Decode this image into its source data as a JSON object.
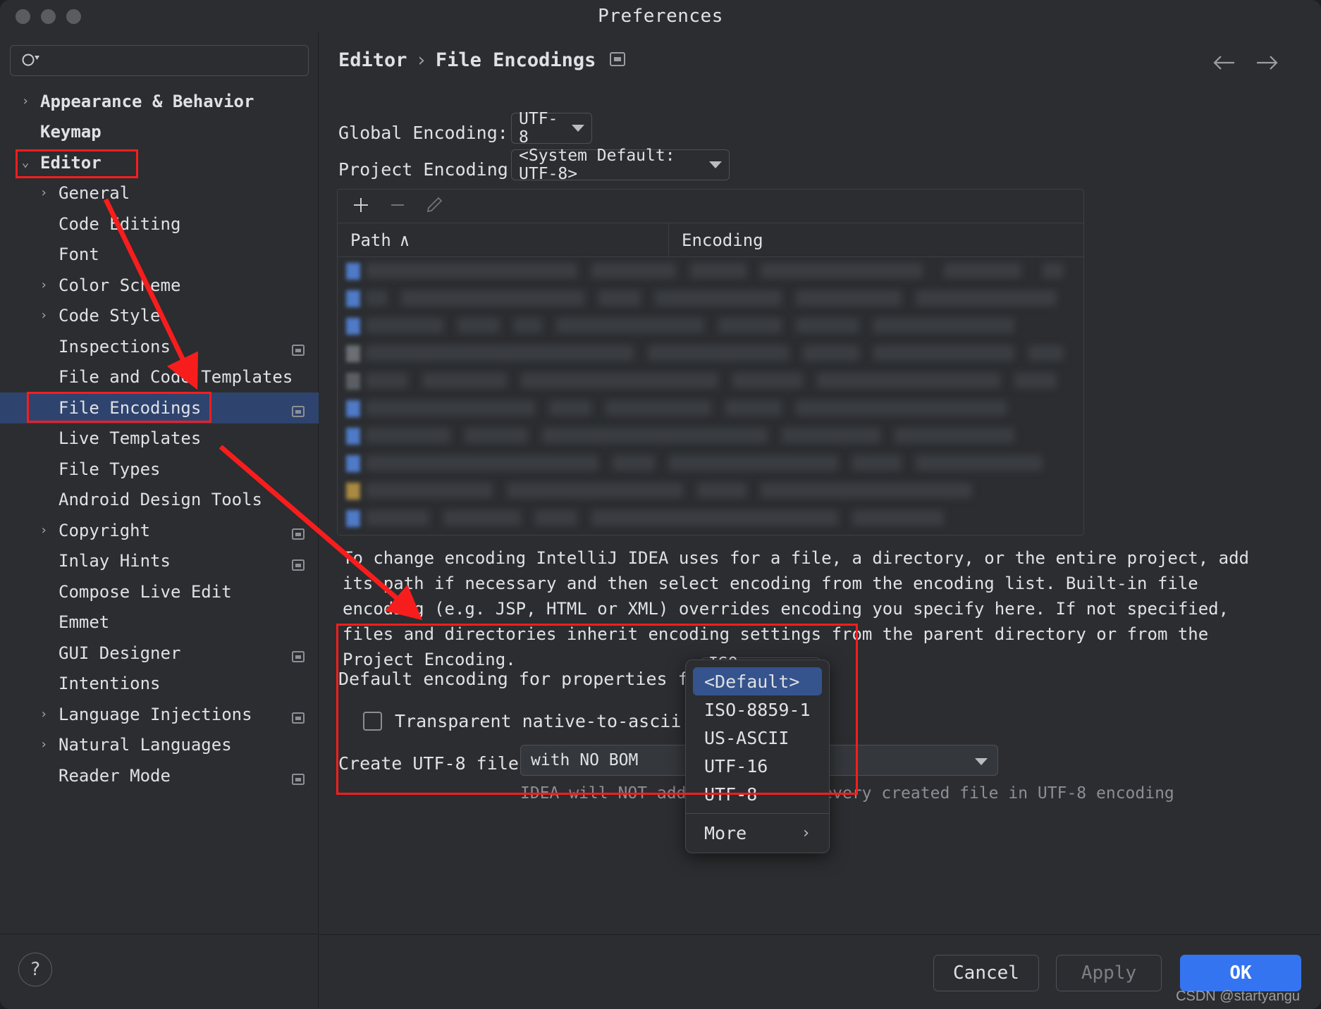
{
  "window": {
    "title": "Preferences",
    "traffic_lights": [
      "close",
      "minimize",
      "zoom"
    ]
  },
  "sidebar": {
    "search": {
      "value": "",
      "placeholder": ""
    },
    "items": [
      {
        "label": "Appearance & Behavior",
        "level": 0,
        "arrow": "›",
        "bold": true,
        "selected": false,
        "mod_icon": false
      },
      {
        "label": "Keymap",
        "level": 0,
        "arrow": "",
        "bold": true,
        "selected": false,
        "mod_icon": false
      },
      {
        "label": "Editor",
        "level": 0,
        "arrow": "⌄",
        "bold": true,
        "selected": false,
        "mod_icon": false
      },
      {
        "label": "General",
        "level": 1,
        "arrow": "›",
        "bold": false,
        "selected": false,
        "mod_icon": false
      },
      {
        "label": "Code Editing",
        "level": 1,
        "arrow": "",
        "bold": false,
        "selected": false,
        "mod_icon": false
      },
      {
        "label": "Font",
        "level": 1,
        "arrow": "",
        "bold": false,
        "selected": false,
        "mod_icon": false
      },
      {
        "label": "Color Scheme",
        "level": 1,
        "arrow": "›",
        "bold": false,
        "selected": false,
        "mod_icon": false
      },
      {
        "label": "Code Style",
        "level": 1,
        "arrow": "›",
        "bold": false,
        "selected": false,
        "mod_icon": false
      },
      {
        "label": "Inspections",
        "level": 1,
        "arrow": "",
        "bold": false,
        "selected": false,
        "mod_icon": true
      },
      {
        "label": "File and Code Templates",
        "level": 1,
        "arrow": "",
        "bold": false,
        "selected": false,
        "mod_icon": false
      },
      {
        "label": "File Encodings",
        "level": 1,
        "arrow": "",
        "bold": false,
        "selected": true,
        "mod_icon": true
      },
      {
        "label": "Live Templates",
        "level": 1,
        "arrow": "",
        "bold": false,
        "selected": false,
        "mod_icon": false
      },
      {
        "label": "File Types",
        "level": 1,
        "arrow": "",
        "bold": false,
        "selected": false,
        "mod_icon": false
      },
      {
        "label": "Android Design Tools",
        "level": 1,
        "arrow": "",
        "bold": false,
        "selected": false,
        "mod_icon": false
      },
      {
        "label": "Copyright",
        "level": 1,
        "arrow": "›",
        "bold": false,
        "selected": false,
        "mod_icon": true
      },
      {
        "label": "Inlay Hints",
        "level": 1,
        "arrow": "",
        "bold": false,
        "selected": false,
        "mod_icon": true
      },
      {
        "label": "Compose Live Edit",
        "level": 1,
        "arrow": "",
        "bold": false,
        "selected": false,
        "mod_icon": false
      },
      {
        "label": "Emmet",
        "level": 1,
        "arrow": "",
        "bold": false,
        "selected": false,
        "mod_icon": false
      },
      {
        "label": "GUI Designer",
        "level": 1,
        "arrow": "",
        "bold": false,
        "selected": false,
        "mod_icon": true
      },
      {
        "label": "Intentions",
        "level": 1,
        "arrow": "",
        "bold": false,
        "selected": false,
        "mod_icon": false
      },
      {
        "label": "Language Injections",
        "level": 1,
        "arrow": "›",
        "bold": false,
        "selected": false,
        "mod_icon": true
      },
      {
        "label": "Natural Languages",
        "level": 1,
        "arrow": "›",
        "bold": false,
        "selected": false,
        "mod_icon": false
      },
      {
        "label": "Reader Mode",
        "level": 1,
        "arrow": "",
        "bold": false,
        "selected": false,
        "mod_icon": true
      }
    ],
    "help_label": "?"
  },
  "main": {
    "breadcrumb": {
      "parent": "Editor",
      "separator": "›",
      "current": "File Encodings"
    },
    "global_encoding": {
      "label": "Global Encoding:",
      "value": "UTF-8"
    },
    "project_encoding": {
      "label": "Project Encoding:",
      "value": "<System Default: UTF-8>"
    },
    "table": {
      "toolbar": [
        "add-icon",
        "remove-icon",
        "edit-icon"
      ],
      "columns": [
        "Path",
        "Encoding"
      ],
      "sort_indicator": "∧",
      "rows_blurred": true,
      "row_count": 10
    },
    "description": "To change encoding IntelliJ IDEA uses for a file, a directory, or the entire project, add\nits path if necessary and then select encoding from the encoding list. Built-in file\nencoding (e.g. JSP, HTML or XML) overrides encoding you specify here. If not specified,\nfiles and directories inherit encoding settings from the parent directory or from the\nProject Encoding.",
    "default_properties_encoding": {
      "label": "Default encoding for properties files:",
      "value": "ISO-8859-1"
    },
    "transparent_conversion": {
      "label": "Transparent native-to-ascii conversion",
      "checked": false
    },
    "create_utf8": {
      "label": "Create UTF-8 files:",
      "value": "with NO BOM",
      "hint_prefix": "IDEA will NOT add ",
      "hint_accent": "UTF-8",
      "hint_suffix": " BOM to every created file in UTF-8 encoding"
    }
  },
  "dropdown": {
    "items": [
      {
        "label": "<Default>",
        "selected": true,
        "submenu": false
      },
      {
        "label": "ISO-8859-1",
        "selected": false,
        "submenu": false
      },
      {
        "label": "US-ASCII",
        "selected": false,
        "submenu": false
      },
      {
        "label": "UTF-16",
        "selected": false,
        "submenu": false
      },
      {
        "label": "UTF-8",
        "selected": false,
        "submenu": false
      }
    ],
    "more": {
      "label": "More",
      "chevron": "›"
    }
  },
  "footer": {
    "cancel": "Cancel",
    "apply": "Apply",
    "ok": "OK",
    "watermark": "CSDN @startyangu"
  },
  "colors": {
    "accent_blue": "#3574f0",
    "selection_blue": "#2e436e",
    "annotation_red": "#f81d1d",
    "window_bg": "#2b2d30",
    "link_blue": "#4a86f7"
  }
}
